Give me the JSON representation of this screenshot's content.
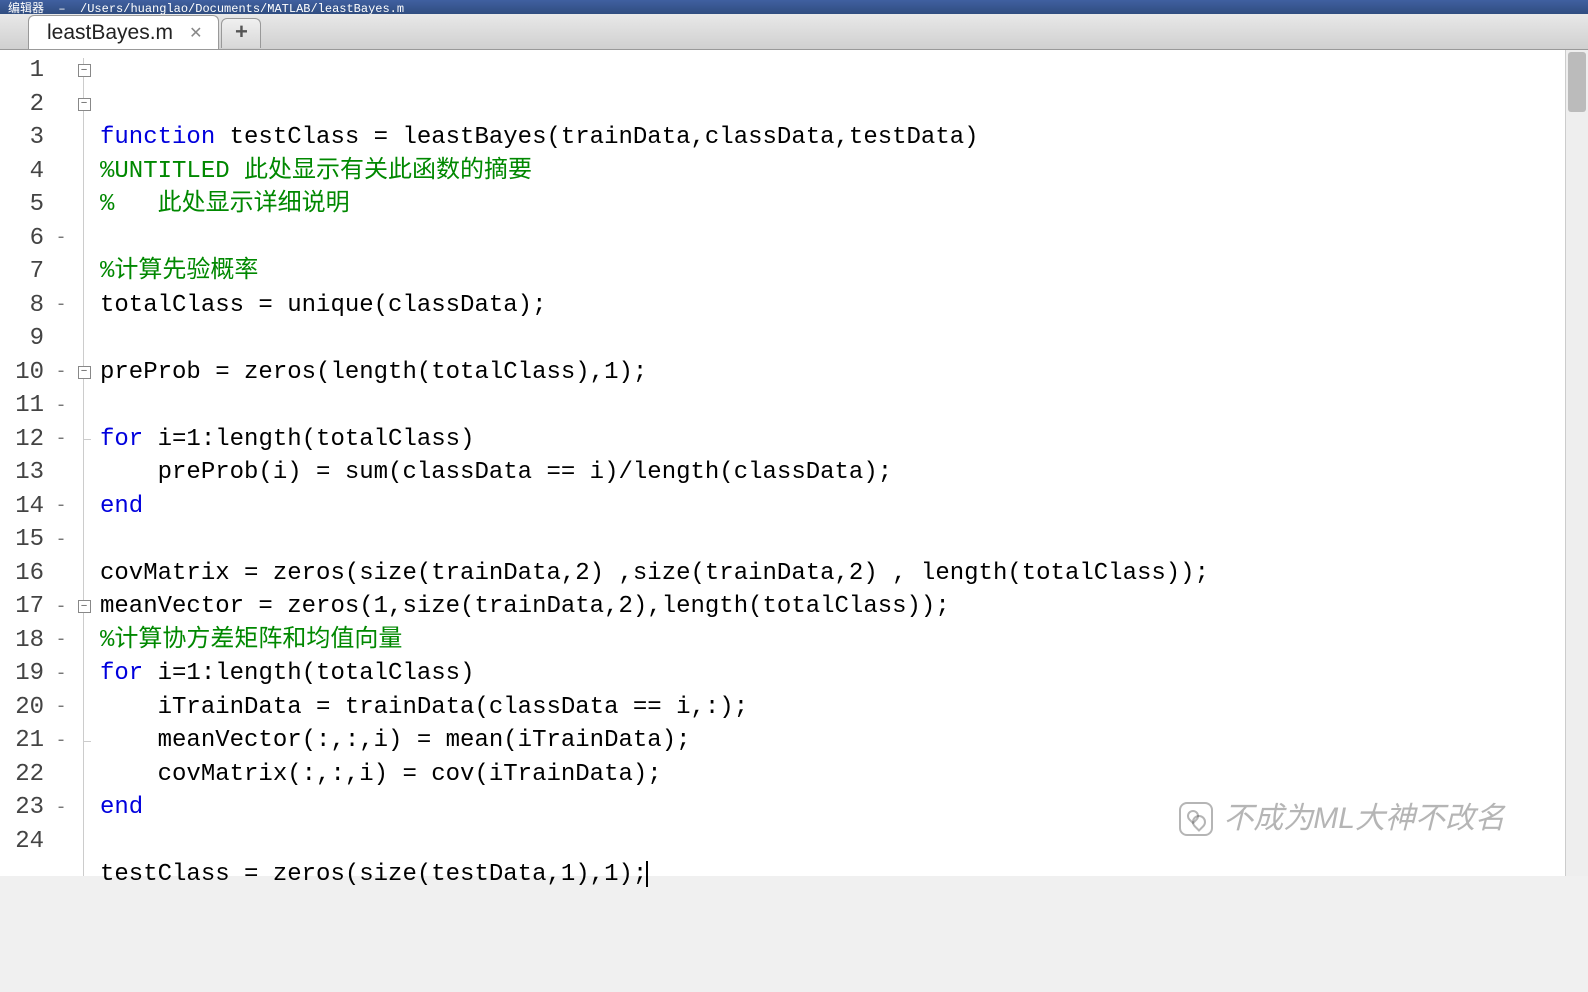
{
  "title_bar": {
    "title_prefix": "编辑器",
    "file_path": "/Users/huanglao/Documents/MATLAB/leastBayes.m"
  },
  "tabs": {
    "active_tab": "leastBayes.m",
    "add_label": "+"
  },
  "gutter": {
    "line_numbers": [
      "1",
      "2",
      "3",
      "4",
      "5",
      "6",
      "7",
      "8",
      "9",
      "10",
      "11",
      "12",
      "13",
      "14",
      "15",
      "16",
      "17",
      "18",
      "19",
      "20",
      "21",
      "22",
      "23",
      "24"
    ],
    "dashes": [
      "",
      "",
      "",
      "",
      "",
      "-",
      "",
      "-",
      "",
      "-",
      "-",
      "-",
      "",
      "-",
      "-",
      "",
      "-",
      "-",
      "-",
      "-",
      "-",
      "",
      "-",
      ""
    ]
  },
  "folds": {
    "1": "minus",
    "2": "minus",
    "10": "minus",
    "12": "end",
    "17": "minus",
    "21": "end"
  },
  "code_lines": [
    {
      "segments": [
        {
          "t": "function",
          "c": "kw"
        },
        {
          "t": " testClass = leastBayes(trainData,classData,testData)"
        }
      ]
    },
    {
      "segments": [
        {
          "t": "%UNTITLED 此处显示有关此函数的摘要",
          "c": "cm"
        }
      ]
    },
    {
      "segments": [
        {
          "t": "%   此处显示详细说明",
          "c": "cm"
        }
      ]
    },
    {
      "segments": []
    },
    {
      "segments": [
        {
          "t": "%计算先验概率",
          "c": "cm"
        }
      ]
    },
    {
      "segments": [
        {
          "t": "totalClass = unique(classData);"
        }
      ]
    },
    {
      "segments": []
    },
    {
      "segments": [
        {
          "t": "preProb = zeros(length(totalClass),1);"
        }
      ]
    },
    {
      "segments": []
    },
    {
      "segments": [
        {
          "t": "for",
          "c": "kw"
        },
        {
          "t": " i=1:length(totalClass)"
        }
      ]
    },
    {
      "segments": [
        {
          "t": "    preProb(i) = sum(classData == i)/length(classData);"
        }
      ]
    },
    {
      "segments": [
        {
          "t": "end",
          "c": "kw"
        }
      ]
    },
    {
      "segments": []
    },
    {
      "segments": [
        {
          "t": "covMatrix = zeros(size(trainData,2) ,size(trainData,2) , length(totalClass));"
        }
      ]
    },
    {
      "segments": [
        {
          "t": "meanVector = zeros(1,size(trainData,2),length(totalClass));"
        }
      ]
    },
    {
      "segments": [
        {
          "t": "%计算协方差矩阵和均值向量",
          "c": "cm"
        }
      ]
    },
    {
      "segments": [
        {
          "t": "for",
          "c": "kw"
        },
        {
          "t": " i=1:length(totalClass)"
        }
      ]
    },
    {
      "segments": [
        {
          "t": "    iTrainData = trainData(classData == i,:);"
        }
      ]
    },
    {
      "segments": [
        {
          "t": "    meanVector(:,:,i) = mean(iTrainData);"
        }
      ]
    },
    {
      "segments": [
        {
          "t": "    covMatrix(:,:,i) = cov(iTrainData);"
        }
      ]
    },
    {
      "segments": [
        {
          "t": "end",
          "c": "kw"
        }
      ]
    },
    {
      "segments": []
    },
    {
      "segments": [
        {
          "t": "testClass = zeros(size(testData,1),1);"
        }
      ],
      "cursor": true
    },
    {
      "segments": []
    }
  ],
  "watermark": {
    "text": "不成为ML大神不改名"
  }
}
